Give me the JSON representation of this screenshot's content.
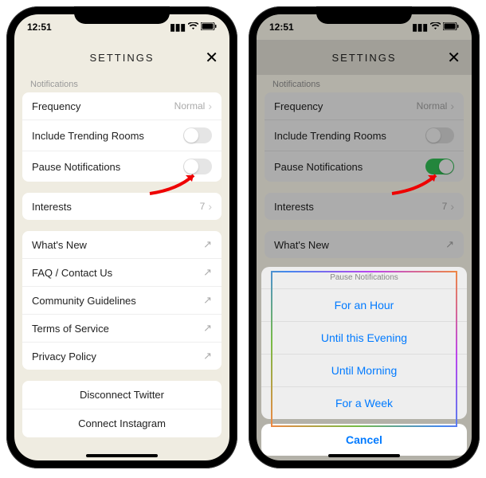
{
  "status": {
    "time": "12:51"
  },
  "header": {
    "title": "SETTINGS"
  },
  "sections": {
    "notifications_label": "Notifications",
    "frequency": {
      "label": "Frequency",
      "value": "Normal"
    },
    "trending": {
      "label": "Include Trending Rooms"
    },
    "pause": {
      "label": "Pause Notifications"
    },
    "interests": {
      "label": "Interests",
      "value": "7"
    },
    "links": {
      "whats_new": "What's New",
      "faq": "FAQ / Contact Us",
      "community": "Community Guidelines",
      "terms": "Terms of Service",
      "privacy": "Privacy Policy"
    },
    "accounts": {
      "disconnect_twitter": "Disconnect Twitter",
      "connect_instagram": "Connect Instagram"
    }
  },
  "sheet": {
    "title": "Pause Notifications",
    "options": [
      "For an Hour",
      "Until this Evening",
      "Until Morning",
      "For a Week"
    ],
    "cancel": "Cancel"
  }
}
